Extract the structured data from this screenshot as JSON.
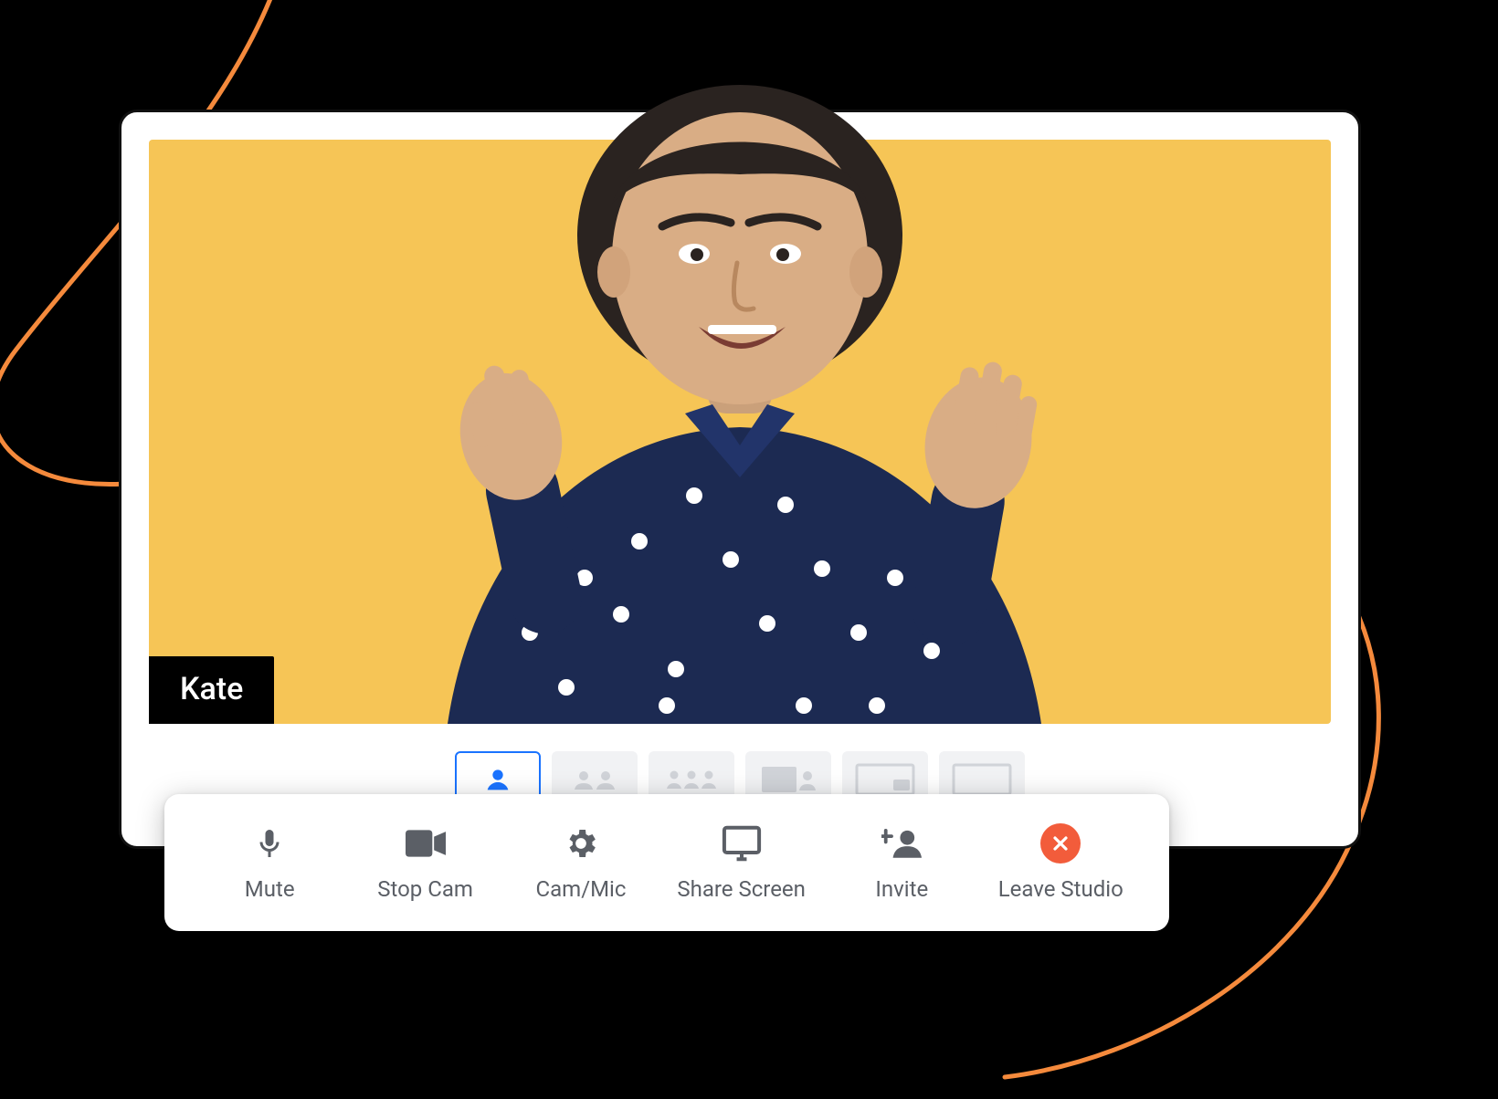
{
  "participant": {
    "name": "Kate"
  },
  "colors": {
    "stage_bg": "#f6c556",
    "accent_blue": "#1a73ff",
    "leave_red": "#f25c3b",
    "swirl_orange": "#f58a3c"
  },
  "layouts": {
    "count": 6,
    "active_index": 0,
    "icons": [
      "single",
      "two-up",
      "three-up",
      "pip",
      "screen-pip",
      "full"
    ]
  },
  "controls": [
    {
      "id": "mute",
      "label": "Mute",
      "icon": "mic-icon"
    },
    {
      "id": "stop-cam",
      "label": "Stop Cam",
      "icon": "camera-icon"
    },
    {
      "id": "cam-mic",
      "label": "Cam/Mic",
      "icon": "gear-icon"
    },
    {
      "id": "share-screen",
      "label": "Share Screen",
      "icon": "screen-share-icon"
    },
    {
      "id": "invite",
      "label": "Invite",
      "icon": "invite-icon"
    },
    {
      "id": "leave",
      "label": "Leave Studio",
      "icon": "close-icon"
    }
  ]
}
